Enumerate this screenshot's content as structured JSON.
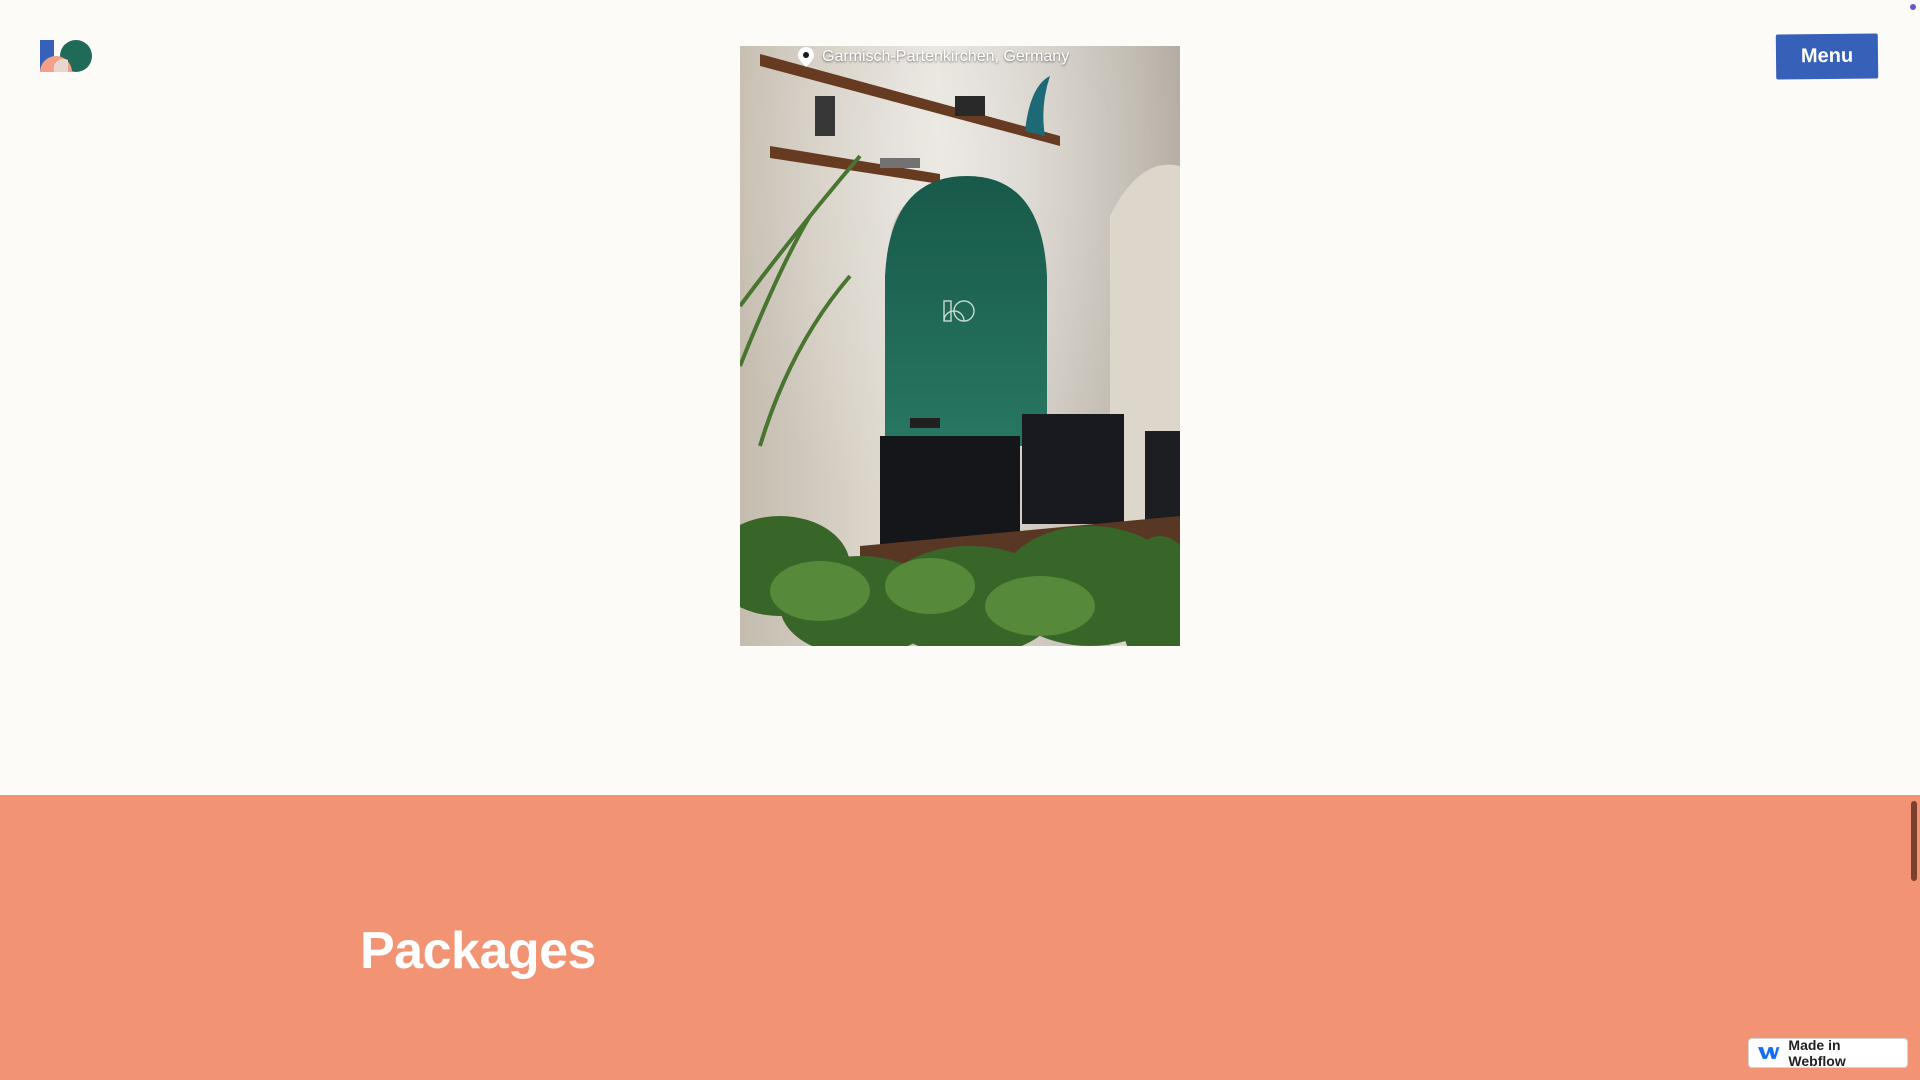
{
  "header": {
    "logo_name": "site-logo",
    "menu_label": "Menu"
  },
  "hero": {
    "location": "Garmisch-Partenkirchen, Germany"
  },
  "packages": {
    "title": "Packages"
  },
  "badge": {
    "label": "Made in Webflow"
  },
  "colors": {
    "page_bg": "#fdfbf8",
    "menu_bg": "#3761b8",
    "packages_bg": "#f29474",
    "arch_green": "#1f6a58"
  }
}
